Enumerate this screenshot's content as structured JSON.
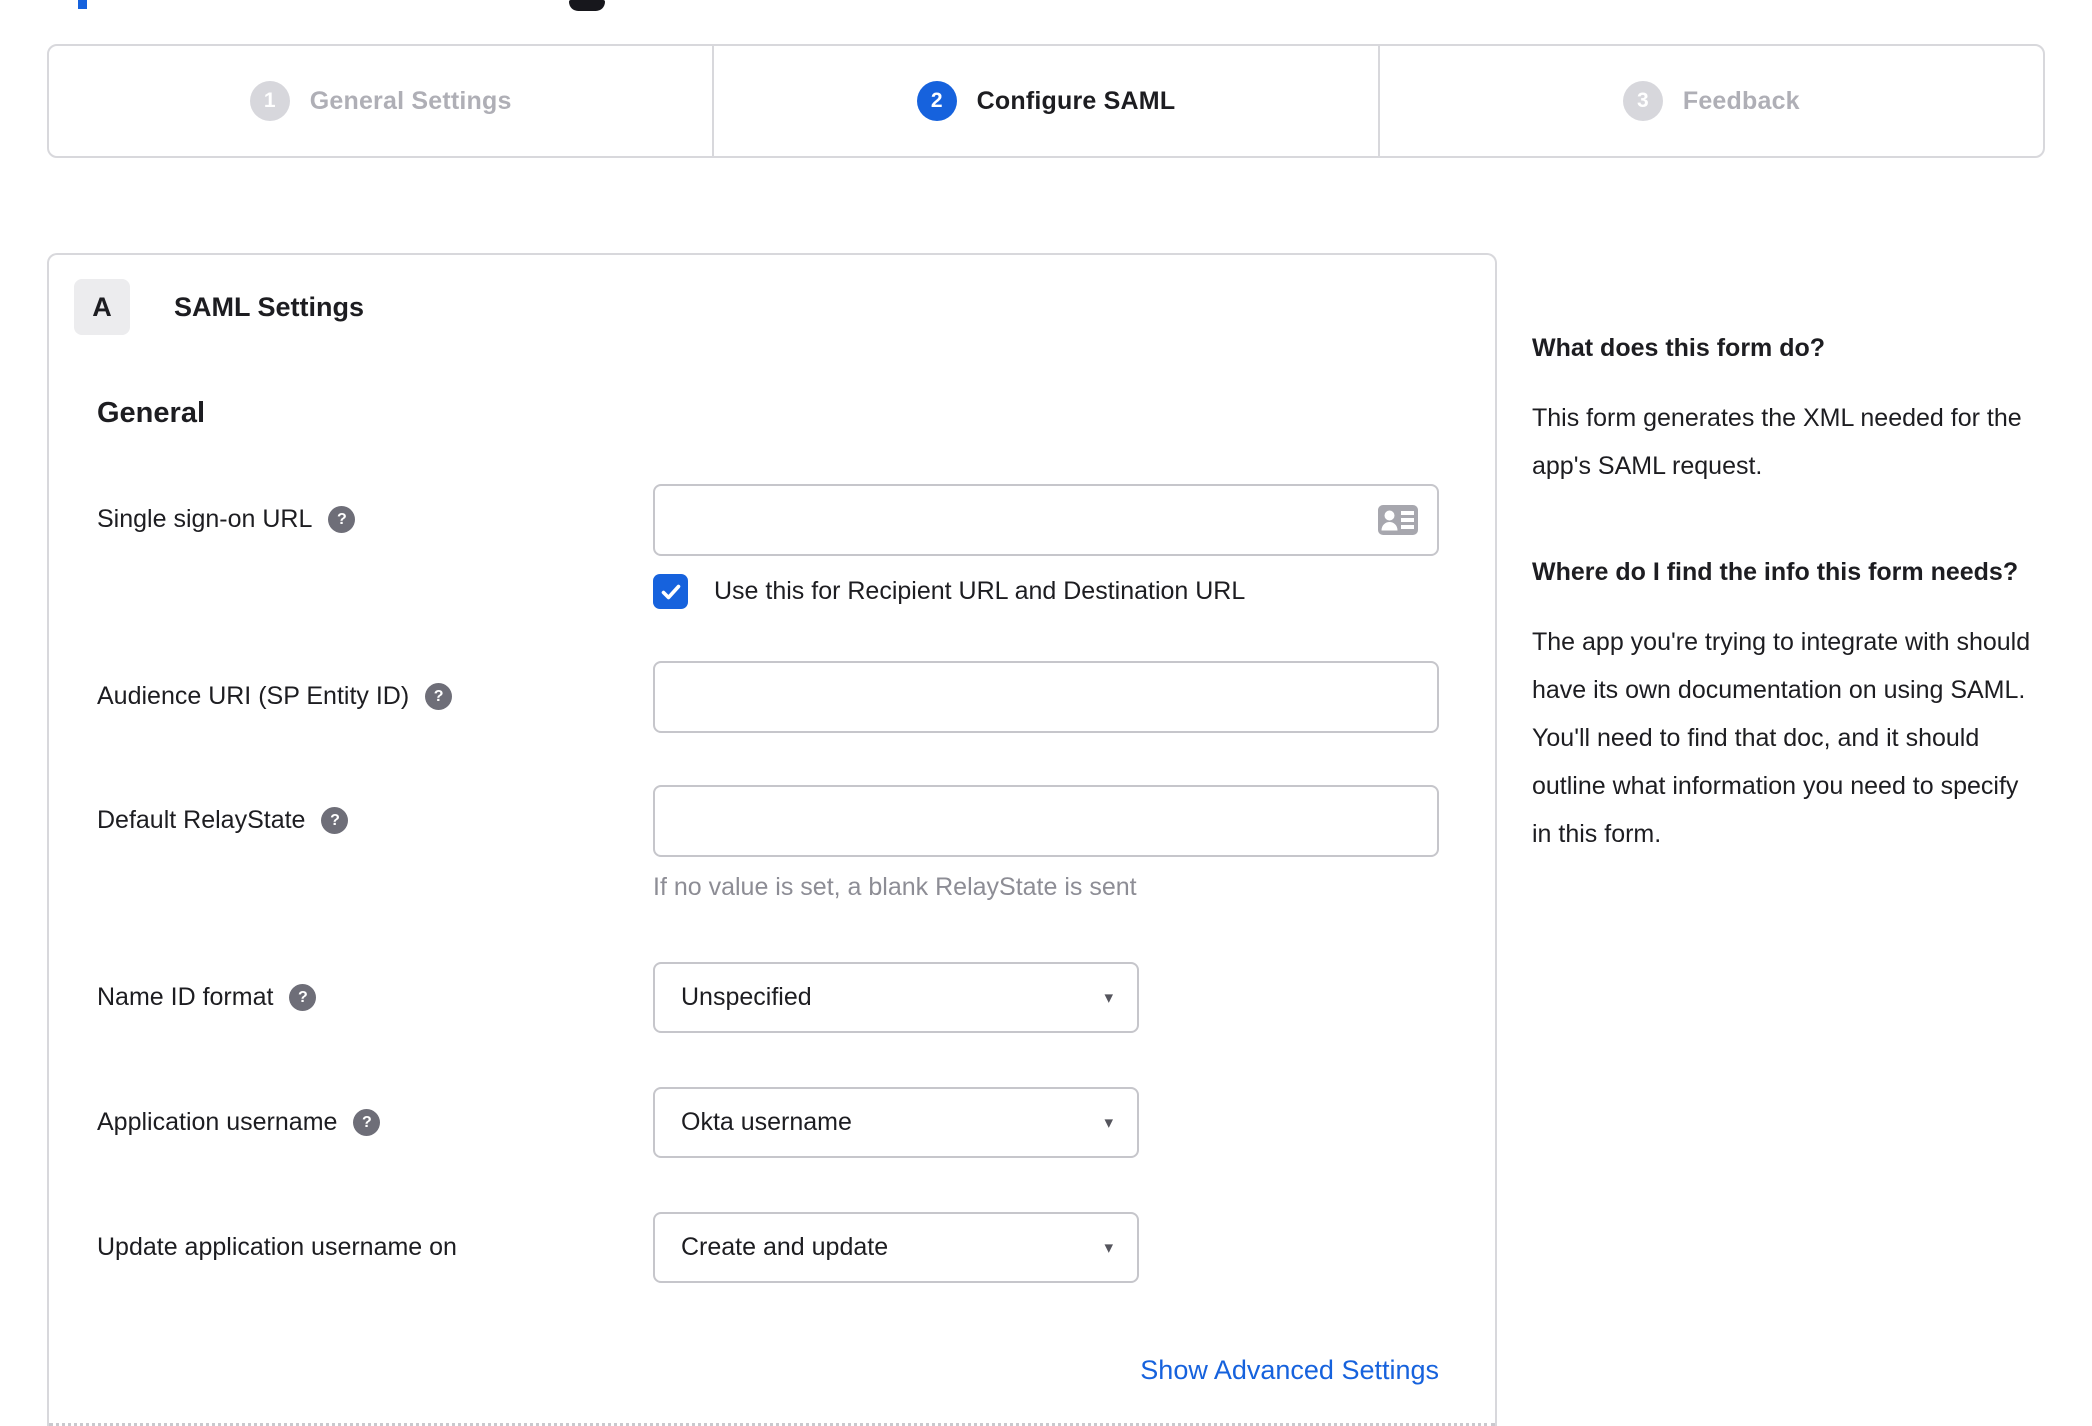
{
  "colors": {
    "accent_blue": "#1662dd",
    "text_dark": "#1d1d21",
    "inactive_gray": "#afafb6",
    "border_gray": "#d8d8dc",
    "hint_gray": "#8d8d95"
  },
  "icons": {
    "help_glyph": "?",
    "caret_glyph": "▾"
  },
  "stepper": {
    "steps": [
      {
        "number": "1",
        "label": "General Settings",
        "state": "inactive"
      },
      {
        "number": "2",
        "label": "Configure SAML",
        "state": "active"
      },
      {
        "number": "3",
        "label": "Feedback",
        "state": "inactive"
      }
    ]
  },
  "panel": {
    "badge": "A",
    "title": "SAML Settings",
    "section_heading": "General"
  },
  "form": {
    "rows": [
      {
        "label": "Single sign-on URL",
        "has_help": true,
        "control": "text",
        "value": "",
        "checkbox": {
          "checked": true,
          "label": "Use this for Recipient URL and Destination URL"
        }
      },
      {
        "label": "Audience URI (SP Entity ID)",
        "has_help": true,
        "control": "text",
        "value": ""
      },
      {
        "label": "Default RelayState",
        "has_help": true,
        "control": "text",
        "value": "",
        "hint": "If no value is set, a blank RelayState is sent"
      },
      {
        "label": "Name ID format",
        "has_help": true,
        "control": "select",
        "value": "Unspecified"
      },
      {
        "label": "Application username",
        "has_help": true,
        "control": "select",
        "value": "Okta username"
      },
      {
        "label": "Update application username on",
        "has_help": false,
        "control": "select",
        "value": "Create and update"
      }
    ],
    "advanced_link": "Show Advanced Settings"
  },
  "sidebar": {
    "sections": [
      {
        "heading": "What does this form do?",
        "body": "This form generates the XML needed for the app's SAML request."
      },
      {
        "heading": "Where do I find the info this form needs?",
        "body": "The app you're trying to integrate with should have its own documentation on using SAML. You'll need to find that doc, and it should outline what information you need to specify in this form."
      }
    ]
  }
}
